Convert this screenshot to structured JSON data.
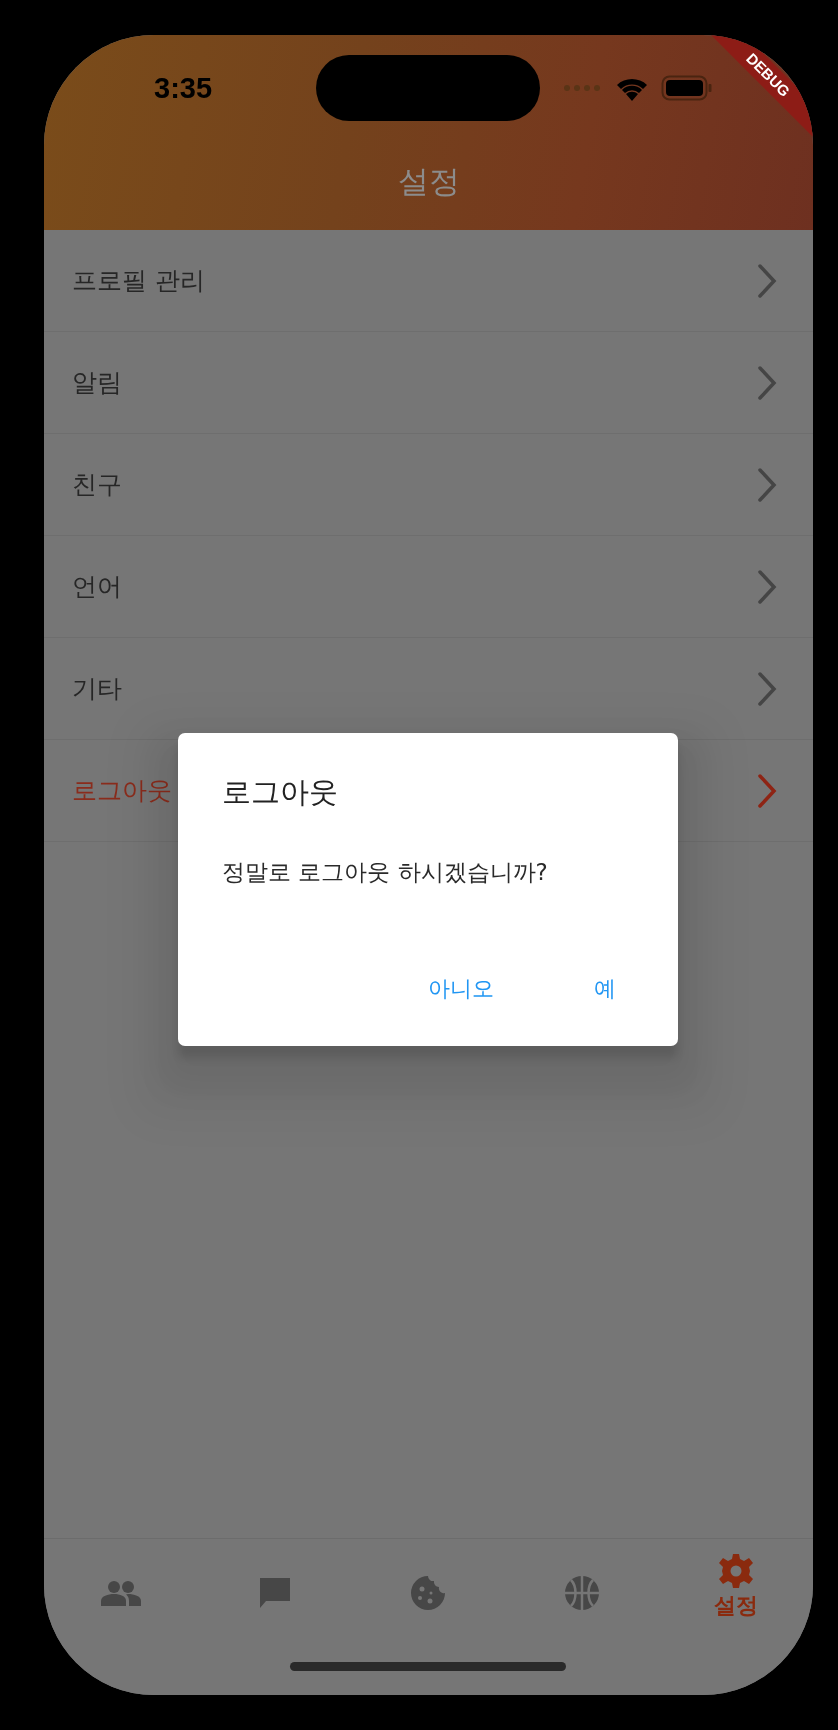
{
  "status_bar": {
    "time": "3:35"
  },
  "debug_banner": "DEBUG",
  "header": {
    "title": "설정"
  },
  "menu": [
    {
      "label": "프로필 관리",
      "kind": "normal"
    },
    {
      "label": "알림",
      "kind": "normal"
    },
    {
      "label": "친구",
      "kind": "normal"
    },
    {
      "label": "언어",
      "kind": "normal"
    },
    {
      "label": "기타",
      "kind": "normal"
    },
    {
      "label": "로그아웃",
      "kind": "danger"
    }
  ],
  "dialog": {
    "title": "로그아웃",
    "message": "정말로 로그아웃 하시겠습니까?",
    "buttons": [
      "아니오",
      "예"
    ]
  },
  "bottom_nav": [
    {
      "kind": "people",
      "selected": false
    },
    {
      "kind": "chat",
      "selected": false
    },
    {
      "kind": "cookie",
      "selected": false
    },
    {
      "kind": "basketball",
      "selected": false
    },
    {
      "kind": "gear",
      "label": "설정",
      "selected": true
    }
  ]
}
